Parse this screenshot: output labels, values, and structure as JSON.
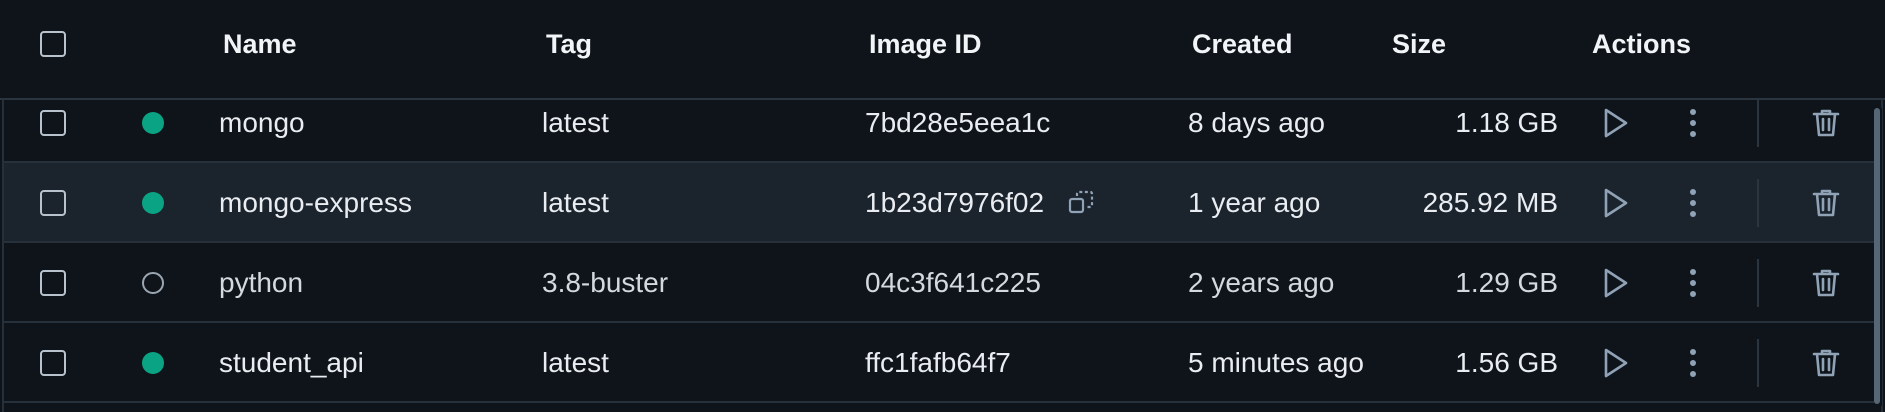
{
  "table": {
    "headers": {
      "name": "Name",
      "tag": "Tag",
      "image_id": "Image ID",
      "created": "Created",
      "size": "Size",
      "actions": "Actions"
    },
    "rows": [
      {
        "name": "mongo",
        "tag": "latest",
        "image_id": "7bd28e5eea1c",
        "created": "8 days ago",
        "size": "1.18 GB",
        "status": "in use",
        "hovered": false
      },
      {
        "name": "mongo-express",
        "tag": "latest",
        "image_id": "1b23d7976f02",
        "created": "1 year ago",
        "size": "285.92 MB",
        "status": "in use",
        "hovered": true
      },
      {
        "name": "python",
        "tag": "3.8-buster",
        "image_id": "04c3f641c225",
        "created": "2 years ago",
        "size": "1.29 GB",
        "status": "unused",
        "hovered": false
      },
      {
        "name": "student_api",
        "tag": "latest",
        "image_id": "ffc1fafb64f7",
        "created": "5 minutes ago",
        "size": "1.56 GB",
        "status": "in use",
        "hovered": false
      }
    ]
  },
  "colors": {
    "background": "#0f141a",
    "row_hover": "#1b232c",
    "status_in_use": "#0aa383",
    "icon": "#8fa2b6",
    "border": "#26303a"
  },
  "icons": {
    "run": "play-icon",
    "more": "kebab-menu-icon",
    "delete": "trash-icon",
    "copy": "copy-icon"
  }
}
